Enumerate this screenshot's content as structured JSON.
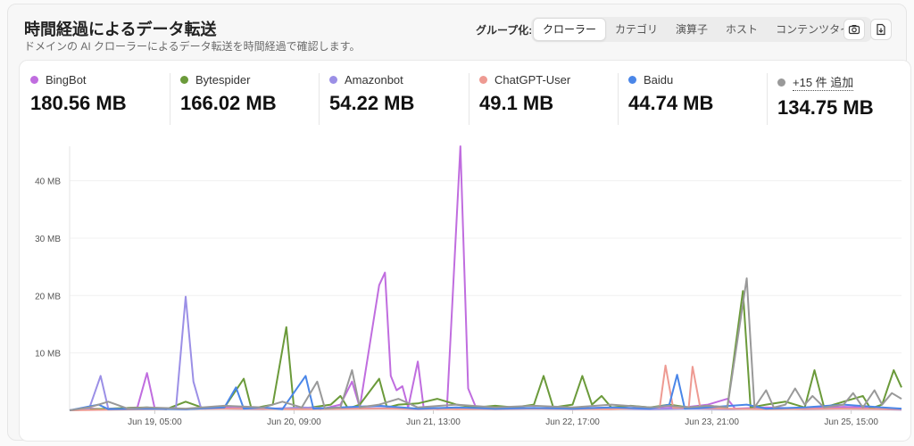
{
  "header": {
    "title": "時間経過によるデータ転送",
    "subtitle": "ドメインの AI クローラーによるデータ転送を時間経過で確認します。",
    "group_label": "グループ化:",
    "group_options": [
      "クローラー",
      "カテゴリ",
      "演算子",
      "ホスト",
      "コンテンツタイプ"
    ],
    "active_group": "クローラー"
  },
  "toolbar": {
    "screenshot_icon": "camera-icon",
    "download_icon": "download-icon"
  },
  "stats": [
    {
      "name": "BingBot",
      "value": "180.56 MB",
      "color": "#c06ddf"
    },
    {
      "name": "Bytespider",
      "value": "166.02 MB",
      "color": "#6b9a3a"
    },
    {
      "name": "Amazonbot",
      "value": "54.22 MB",
      "color": "#9b8fe6"
    },
    {
      "name": "ChatGPT-User",
      "value": "49.1 MB",
      "color": "#ee9a92"
    },
    {
      "name": "Baidu",
      "value": "44.74 MB",
      "color": "#4a86e8"
    },
    {
      "name": "+15 件 追加",
      "value": "134.75 MB",
      "color": "#999999"
    }
  ],
  "chart_data": {
    "type": "line",
    "ylim": [
      0,
      46
    ],
    "yticks": [
      10,
      20,
      30,
      40
    ],
    "ytick_labels": [
      "10 MB",
      "20 MB",
      "30 MB",
      "40 MB"
    ],
    "xtick_labels": [
      "Jun 19, 05:00",
      "Jun 20, 09:00",
      "Jun 21, 13:00",
      "Jun 22, 17:00",
      "Jun 23, 21:00",
      "Jun 25, 15:00"
    ],
    "xtick_positions": [
      4.4,
      11.6,
      18.8,
      26.0,
      33.2,
      40.4
    ],
    "xlim": [
      0,
      43
    ],
    "series": [
      {
        "name": "BingBot",
        "color": "#c06ddf",
        "points": [
          [
            0,
            0
          ],
          [
            1,
            0.3
          ],
          [
            2,
            0.2
          ],
          [
            3.5,
            0.5
          ],
          [
            4.0,
            6.5
          ],
          [
            4.4,
            0.3
          ],
          [
            6,
            0.2
          ],
          [
            8,
            0.5
          ],
          [
            10,
            0.3
          ],
          [
            12,
            0.4
          ],
          [
            13,
            0.2
          ],
          [
            14,
            1.0
          ],
          [
            14.6,
            5.0
          ],
          [
            15,
            0.5
          ],
          [
            16,
            21.8
          ],
          [
            16.3,
            24.0
          ],
          [
            16.6,
            6.0
          ],
          [
            16.9,
            3.5
          ],
          [
            17.2,
            4.2
          ],
          [
            17.5,
            0.5
          ],
          [
            18,
            8.5
          ],
          [
            18.3,
            0.5
          ],
          [
            19,
            0.2
          ],
          [
            19.5,
            0.3
          ],
          [
            20.2,
            46.0
          ],
          [
            20.6,
            3.8
          ],
          [
            21,
            0.5
          ],
          [
            22,
            0.3
          ],
          [
            24,
            0.4
          ],
          [
            26,
            0.3
          ],
          [
            28,
            0.5
          ],
          [
            30,
            0.3
          ],
          [
            32,
            0.6
          ],
          [
            33,
            1.0
          ],
          [
            34,
            2.0
          ],
          [
            34.4,
            0.3
          ],
          [
            36,
            0.5
          ],
          [
            38,
            0.3
          ],
          [
            40,
            0.6
          ],
          [
            42,
            0.4
          ],
          [
            43,
            0.2
          ]
        ]
      },
      {
        "name": "Bytespider",
        "color": "#6b9a3a",
        "points": [
          [
            0,
            0
          ],
          [
            2,
            0.3
          ],
          [
            4,
            0.5
          ],
          [
            5,
            0.2
          ],
          [
            6,
            1.5
          ],
          [
            7,
            0.3
          ],
          [
            8,
            0.5
          ],
          [
            9,
            5.5
          ],
          [
            9.4,
            0.3
          ],
          [
            10.5,
            1.0
          ],
          [
            11.2,
            14.5
          ],
          [
            11.6,
            0.3
          ],
          [
            12.5,
            0.5
          ],
          [
            13.5,
            1.0
          ],
          [
            14,
            2.5
          ],
          [
            14.4,
            0.3
          ],
          [
            15,
            1.0
          ],
          [
            16,
            5.5
          ],
          [
            16.4,
            0.5
          ],
          [
            17,
            1.0
          ],
          [
            18,
            1.2
          ],
          [
            19,
            2.0
          ],
          [
            20,
            1.0
          ],
          [
            21,
            0.5
          ],
          [
            22,
            0.8
          ],
          [
            23,
            0.5
          ],
          [
            24,
            1.0
          ],
          [
            24.5,
            6.0
          ],
          [
            25,
            0.5
          ],
          [
            26,
            1.0
          ],
          [
            26.5,
            6.0
          ],
          [
            27,
            1.0
          ],
          [
            27.5,
            2.5
          ],
          [
            28,
            0.5
          ],
          [
            29,
            0.8
          ],
          [
            30,
            0.5
          ],
          [
            31,
            1.0
          ],
          [
            32,
            0.5
          ],
          [
            33,
            0.8
          ],
          [
            34,
            0.5
          ],
          [
            34.8,
            20.8
          ],
          [
            35.2,
            0.5
          ],
          [
            36,
            1.0
          ],
          [
            37,
            1.5
          ],
          [
            38,
            0.5
          ],
          [
            38.5,
            7.0
          ],
          [
            39,
            0.5
          ],
          [
            40,
            1.5
          ],
          [
            41,
            2.5
          ],
          [
            41.4,
            0.3
          ],
          [
            42,
            1.0
          ],
          [
            42.6,
            7.0
          ],
          [
            43,
            4.0
          ]
        ]
      },
      {
        "name": "Amazonbot",
        "color": "#9b8fe6",
        "points": [
          [
            0,
            0
          ],
          [
            1,
            0.2
          ],
          [
            1.6,
            6.0
          ],
          [
            2,
            0.3
          ],
          [
            3,
            0.2
          ],
          [
            4,
            0.3
          ],
          [
            5,
            0.2
          ],
          [
            5.5,
            0.5
          ],
          [
            6.0,
            19.8
          ],
          [
            6.4,
            5.0
          ],
          [
            6.8,
            0.3
          ],
          [
            8,
            0.3
          ],
          [
            10,
            0.2
          ],
          [
            12,
            0.5
          ],
          [
            14,
            0.3
          ],
          [
            16,
            0.4
          ],
          [
            18,
            0.2
          ],
          [
            20,
            0.3
          ],
          [
            22,
            0.2
          ],
          [
            24,
            0.3
          ],
          [
            26,
            0.2
          ],
          [
            28,
            0.3
          ],
          [
            30,
            0.2
          ],
          [
            32,
            0.3
          ],
          [
            34,
            0.2
          ],
          [
            36,
            0.3
          ],
          [
            38,
            0.2
          ],
          [
            40,
            0.3
          ],
          [
            42,
            0.2
          ],
          [
            43,
            0.1
          ]
        ]
      },
      {
        "name": "ChatGPT-User",
        "color": "#ee9a92",
        "points": [
          [
            0,
            0
          ],
          [
            4,
            0.2
          ],
          [
            8,
            0.3
          ],
          [
            12,
            0.2
          ],
          [
            16,
            0.3
          ],
          [
            20,
            0.2
          ],
          [
            24,
            0.3
          ],
          [
            28,
            0.2
          ],
          [
            30.5,
            0.5
          ],
          [
            30.8,
            7.8
          ],
          [
            31.2,
            0.4
          ],
          [
            32,
            0.5
          ],
          [
            32.2,
            7.6
          ],
          [
            32.6,
            0.4
          ],
          [
            34,
            0.3
          ],
          [
            36,
            0.2
          ],
          [
            40,
            0.3
          ],
          [
            43,
            0.2
          ]
        ]
      },
      {
        "name": "Baidu",
        "color": "#4a86e8",
        "points": [
          [
            0,
            0
          ],
          [
            1.5,
            1.0
          ],
          [
            2,
            0.2
          ],
          [
            4,
            0.3
          ],
          [
            6,
            0.2
          ],
          [
            8,
            0.5
          ],
          [
            8.6,
            4.0
          ],
          [
            9,
            0.3
          ],
          [
            10,
            0.5
          ],
          [
            11,
            0.2
          ],
          [
            12.2,
            6.0
          ],
          [
            12.6,
            0.3
          ],
          [
            14,
            0.5
          ],
          [
            16,
            0.8
          ],
          [
            18,
            0.3
          ],
          [
            20,
            0.5
          ],
          [
            22,
            0.3
          ],
          [
            24,
            0.4
          ],
          [
            26,
            0.3
          ],
          [
            28,
            0.5
          ],
          [
            30,
            0.3
          ],
          [
            31,
            1.0
          ],
          [
            31.4,
            6.2
          ],
          [
            31.8,
            0.3
          ],
          [
            33,
            0.5
          ],
          [
            35,
            1.0
          ],
          [
            36,
            0.3
          ],
          [
            38,
            0.5
          ],
          [
            40,
            1.0
          ],
          [
            42,
            0.5
          ],
          [
            43,
            0.3
          ]
        ]
      },
      {
        "name": "+15 件 追加",
        "color": "#999999",
        "points": [
          [
            0,
            0
          ],
          [
            1,
            0.5
          ],
          [
            2,
            1.5
          ],
          [
            3,
            0.3
          ],
          [
            4,
            0.5
          ],
          [
            6,
            0.3
          ],
          [
            8,
            0.8
          ],
          [
            10,
            0.5
          ],
          [
            11,
            1.5
          ],
          [
            12,
            0.5
          ],
          [
            12.8,
            5.0
          ],
          [
            13.2,
            0.3
          ],
          [
            14,
            0.5
          ],
          [
            14.6,
            7.0
          ],
          [
            15,
            0.5
          ],
          [
            16,
            1.0
          ],
          [
            17,
            2.0
          ],
          [
            18,
            0.5
          ],
          [
            20,
            1.0
          ],
          [
            22,
            0.5
          ],
          [
            24,
            0.8
          ],
          [
            26,
            0.5
          ],
          [
            28,
            1.0
          ],
          [
            30,
            0.5
          ],
          [
            31,
            0.8
          ],
          [
            32,
            0.5
          ],
          [
            33,
            0.8
          ],
          [
            34,
            0.5
          ],
          [
            35.0,
            23.0
          ],
          [
            35.4,
            0.5
          ],
          [
            36,
            3.5
          ],
          [
            36.4,
            0.5
          ],
          [
            37,
            1.0
          ],
          [
            37.5,
            3.8
          ],
          [
            38,
            1.0
          ],
          [
            38.4,
            2.5
          ],
          [
            39,
            0.5
          ],
          [
            40,
            1.0
          ],
          [
            40.5,
            3.0
          ],
          [
            41,
            0.5
          ],
          [
            41.6,
            3.5
          ],
          [
            42,
            1.0
          ],
          [
            42.5,
            3.0
          ],
          [
            43,
            2.0
          ]
        ]
      }
    ]
  }
}
